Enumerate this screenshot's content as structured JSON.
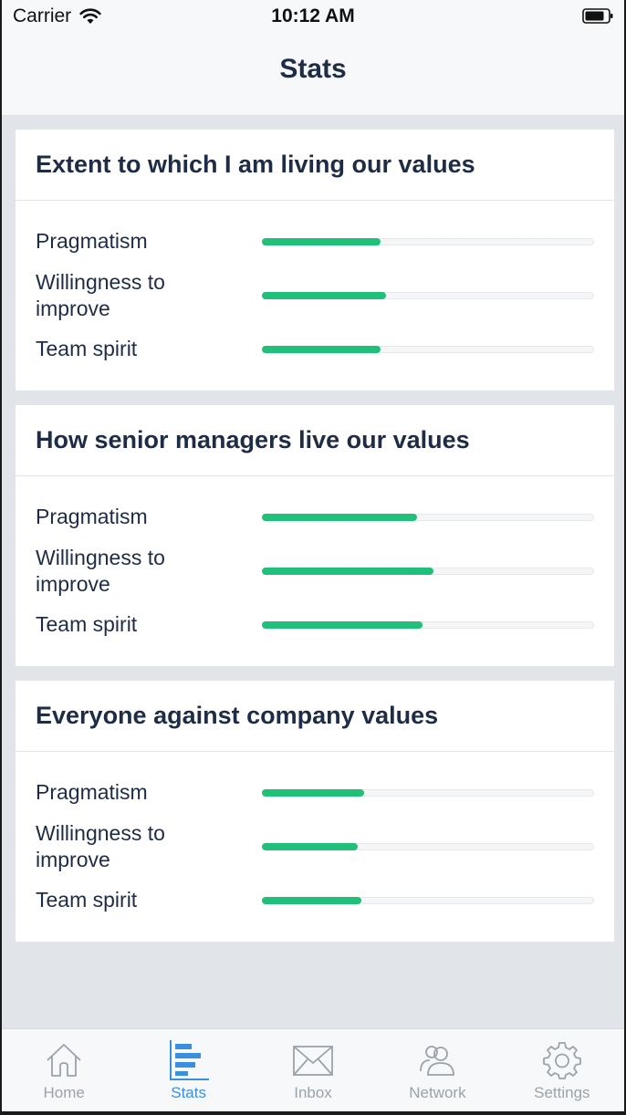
{
  "status_bar": {
    "carrier": "Carrier",
    "time": "10:12 AM"
  },
  "nav": {
    "title": "Stats"
  },
  "colors": {
    "accent": "#21c07a",
    "title": "#1e2d45",
    "tab_active": "#3a8fe0",
    "tab_inactive": "#9aa2ab"
  },
  "cards": [
    {
      "title": "Extent to which I am living our values",
      "metrics": [
        {
          "label": "Pragmatism",
          "progress": 0.36
        },
        {
          "label": "Willingness to improve",
          "progress": 0.375
        },
        {
          "label": "Team spirit",
          "progress": 0.36
        }
      ]
    },
    {
      "title": "How senior managers live our values",
      "metrics": [
        {
          "label": "Pragmatism",
          "progress": 0.47
        },
        {
          "label": "Willingness to improve",
          "progress": 0.52
        },
        {
          "label": "Team spirit",
          "progress": 0.485
        }
      ]
    },
    {
      "title": "Everyone against company values",
      "metrics": [
        {
          "label": "Pragmatism",
          "progress": 0.31
        },
        {
          "label": "Willingness to improve",
          "progress": 0.29
        },
        {
          "label": "Team spirit",
          "progress": 0.3
        }
      ]
    }
  ],
  "tabs": [
    {
      "label": "Home",
      "icon": "home-icon",
      "active": false
    },
    {
      "label": "Stats",
      "icon": "stats-icon",
      "active": true
    },
    {
      "label": "Inbox",
      "icon": "inbox-icon",
      "active": false
    },
    {
      "label": "Network",
      "icon": "network-icon",
      "active": false
    },
    {
      "label": "Settings",
      "icon": "settings-icon",
      "active": false
    }
  ]
}
